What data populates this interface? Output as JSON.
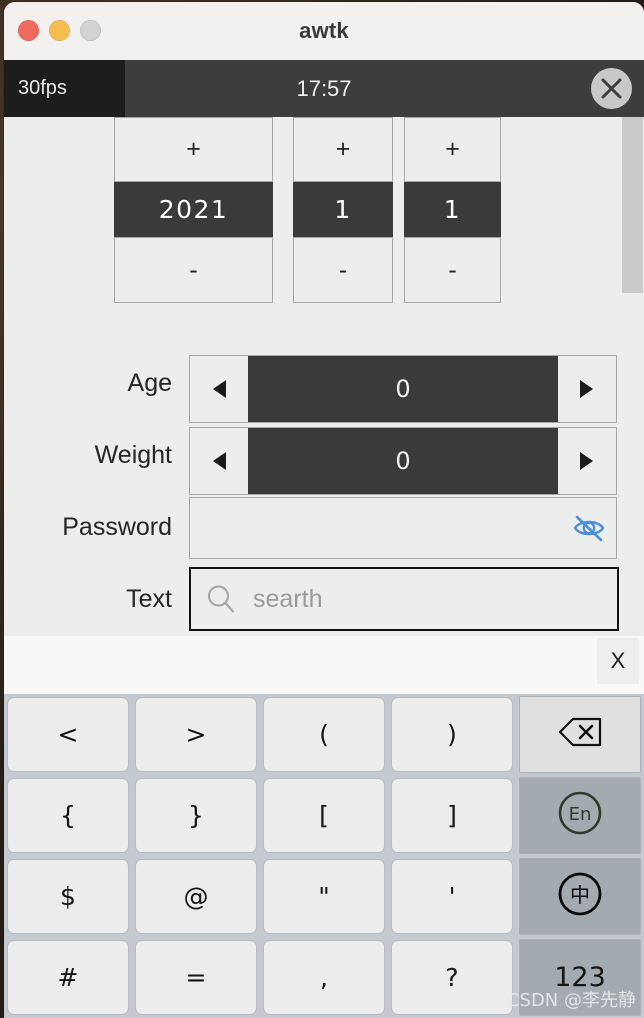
{
  "window": {
    "title": "awtk",
    "traffic_lights": [
      "close",
      "minimize",
      "maximize"
    ]
  },
  "system_bar": {
    "fps": "30fps",
    "clock": "17:57",
    "close_icon": "close-x-icon"
  },
  "form": {
    "date_spinner": {
      "year": {
        "plus": "+",
        "value": "2021",
        "minus": "-"
      },
      "month": {
        "plus": "+",
        "value": "1",
        "minus": "-"
      },
      "day": {
        "plus": "+",
        "value": "1",
        "minus": "-"
      }
    },
    "rows": [
      {
        "label": "Age",
        "type": "spinbox",
        "value": "0",
        "left_icon": "triangle-left-icon",
        "right_icon": "triangle-right-icon"
      },
      {
        "label": "Weight",
        "type": "spinbox",
        "value": "0",
        "left_icon": "triangle-left-icon",
        "right_icon": "triangle-right-icon"
      },
      {
        "label": "Password",
        "type": "password",
        "value": "",
        "reveal_icon": "eye-off-icon",
        "reveal_color": "#4d90d8"
      },
      {
        "label": "Text",
        "type": "search",
        "value": "",
        "placeholder": "searth",
        "search_icon": "magnifier-icon"
      }
    ]
  },
  "scrollbar": {
    "orientation": "vertical",
    "thumb_top_pct": 0,
    "thumb_height_pct": 34
  },
  "keyboard": {
    "candidate_bar": {
      "close_label": "X"
    },
    "keys": [
      {
        "label": "<",
        "name": "key-less-than",
        "style": "normal"
      },
      {
        "label": ">",
        "name": "key-greater-than",
        "style": "normal"
      },
      {
        "label": "(",
        "name": "key-paren-open",
        "style": "normal"
      },
      {
        "label": ")",
        "name": "key-paren-close",
        "style": "normal"
      },
      {
        "label": "",
        "name": "key-backspace",
        "style": "fn-backspace",
        "icon": "backspace-icon"
      },
      {
        "label": "{",
        "name": "key-brace-open",
        "style": "normal"
      },
      {
        "label": "}",
        "name": "key-brace-close",
        "style": "normal"
      },
      {
        "label": "[",
        "name": "key-bracket-open",
        "style": "normal"
      },
      {
        "label": "]",
        "name": "key-bracket-close",
        "style": "normal"
      },
      {
        "label": "En",
        "name": "key-lang-english",
        "style": "fn-dark",
        "icon": "circle-en-icon"
      },
      {
        "label": "$",
        "name": "key-dollar",
        "style": "normal"
      },
      {
        "label": "@",
        "name": "key-at",
        "style": "normal"
      },
      {
        "label": "\"",
        "name": "key-double-quote",
        "style": "normal"
      },
      {
        "label": "'",
        "name": "key-single-quote",
        "style": "normal"
      },
      {
        "label": "中",
        "name": "key-lang-chinese",
        "style": "fn-dark",
        "icon": "circle-zhong-icon"
      },
      {
        "label": "#",
        "name": "key-hash",
        "style": "normal"
      },
      {
        "label": "=",
        "name": "key-equals",
        "style": "normal"
      },
      {
        "label": ",",
        "name": "key-comma",
        "style": "normal"
      },
      {
        "label": "?",
        "name": "key-question",
        "style": "normal"
      },
      {
        "label": "123",
        "name": "key-numeric-mode",
        "style": "fn-num"
      }
    ]
  },
  "watermark": {
    "text": "CSDN @李先静"
  }
}
